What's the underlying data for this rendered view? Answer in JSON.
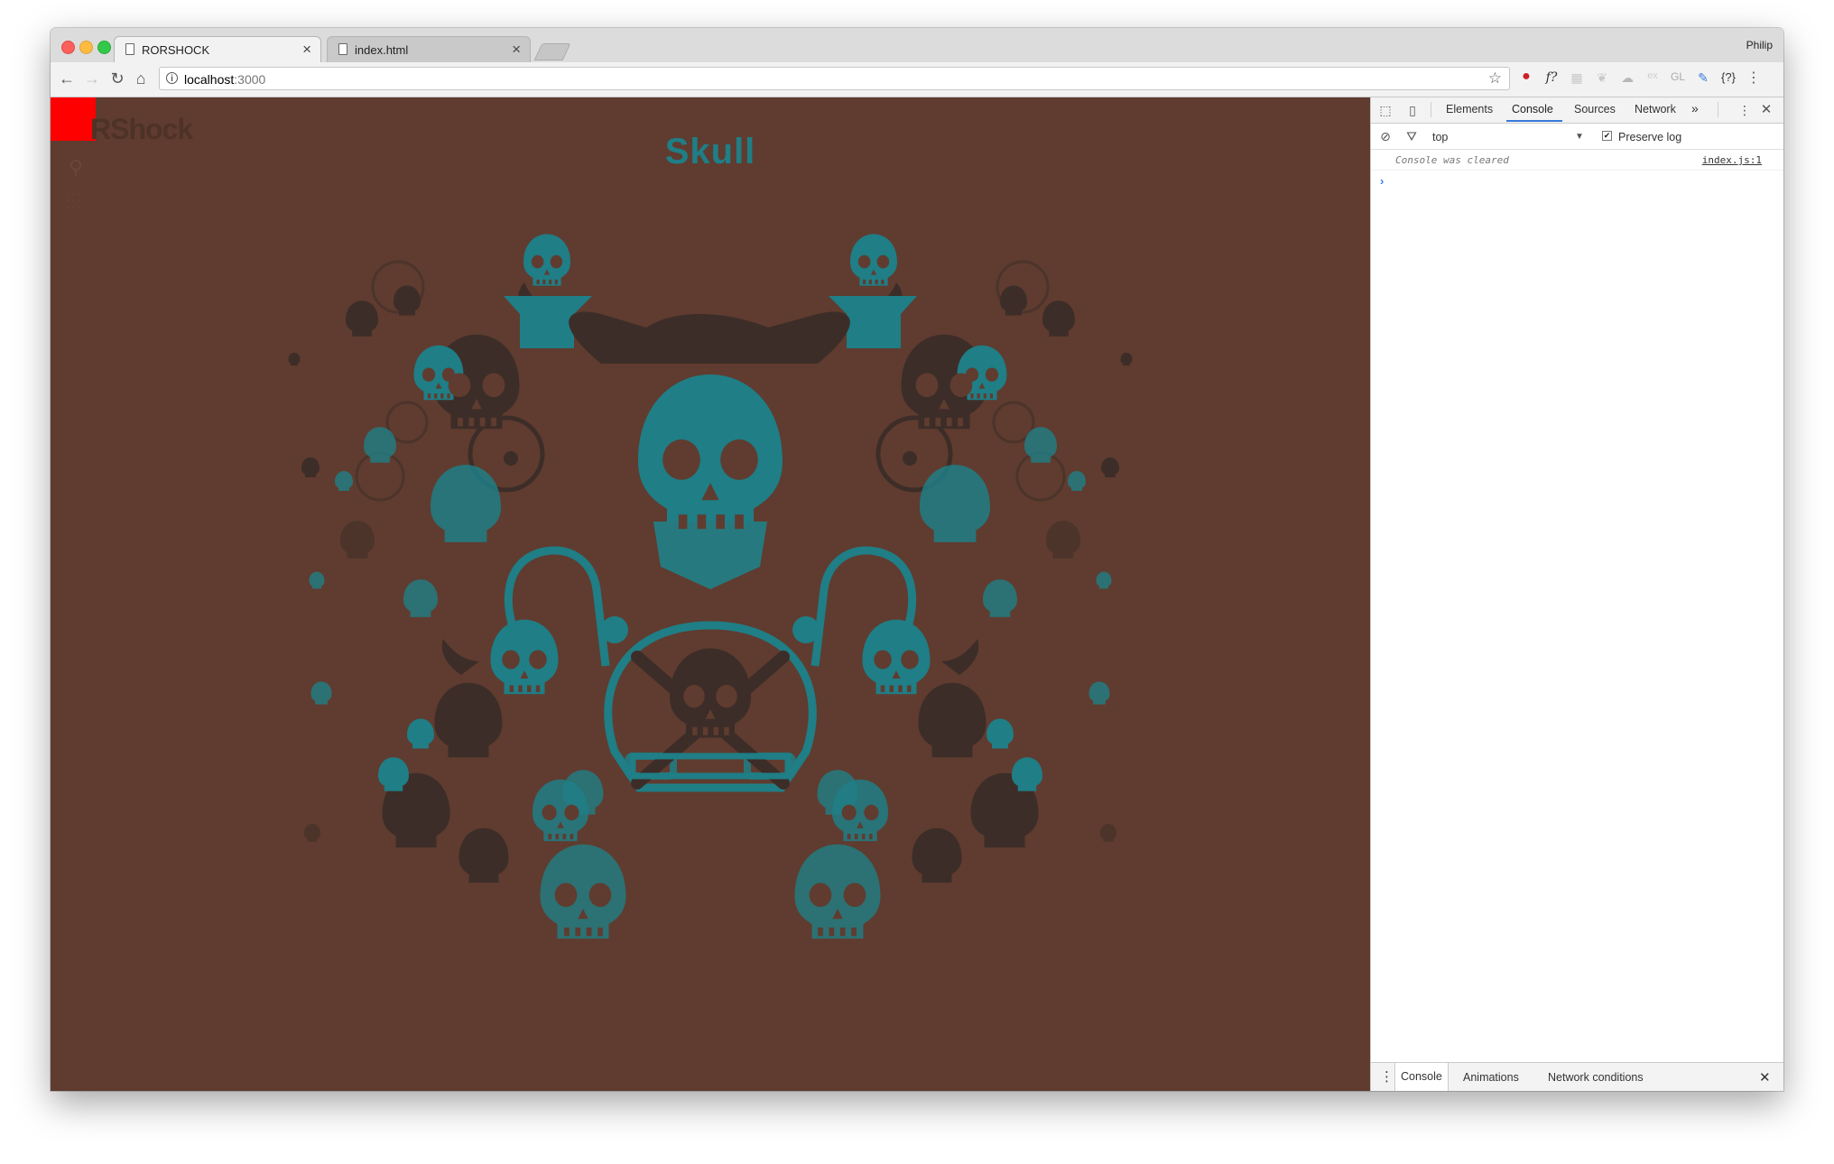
{
  "browser": {
    "profile_name": "Philip",
    "tabs": [
      {
        "title": "RORSHOCK",
        "active": true
      },
      {
        "title": "index.html",
        "active": false
      }
    ],
    "address": {
      "host": "localhost",
      "port": ":3000"
    },
    "extensions": [
      "pinterest-icon",
      "fontface-icon",
      "grid-icon",
      "leaf-icon",
      "cloud-icon",
      "ex-icon",
      "gl-icon",
      "eyedropper-icon",
      "json-icon"
    ],
    "ext_labels": {
      "font": "f?",
      "ex": "ex",
      "gl": "GL",
      "json": "{?}"
    }
  },
  "page": {
    "brand": "RShock",
    "title": "Skull",
    "colors": {
      "background": "#5f3c2f",
      "teal": "#1f7e86",
      "dark": "#3d2d28",
      "accent": "#ff0000"
    }
  },
  "devtools": {
    "tabs": [
      "Elements",
      "Console",
      "Sources",
      "Network"
    ],
    "active_tab": "Console",
    "more": "»",
    "context": "top",
    "preserve_log_label": "Preserve log",
    "preserve_log_checked": true,
    "console_messages": [
      {
        "text": "Console was cleared",
        "source": "index.js:1"
      }
    ],
    "drawer_tabs": [
      "Console",
      "Animations",
      "Network conditions"
    ]
  }
}
